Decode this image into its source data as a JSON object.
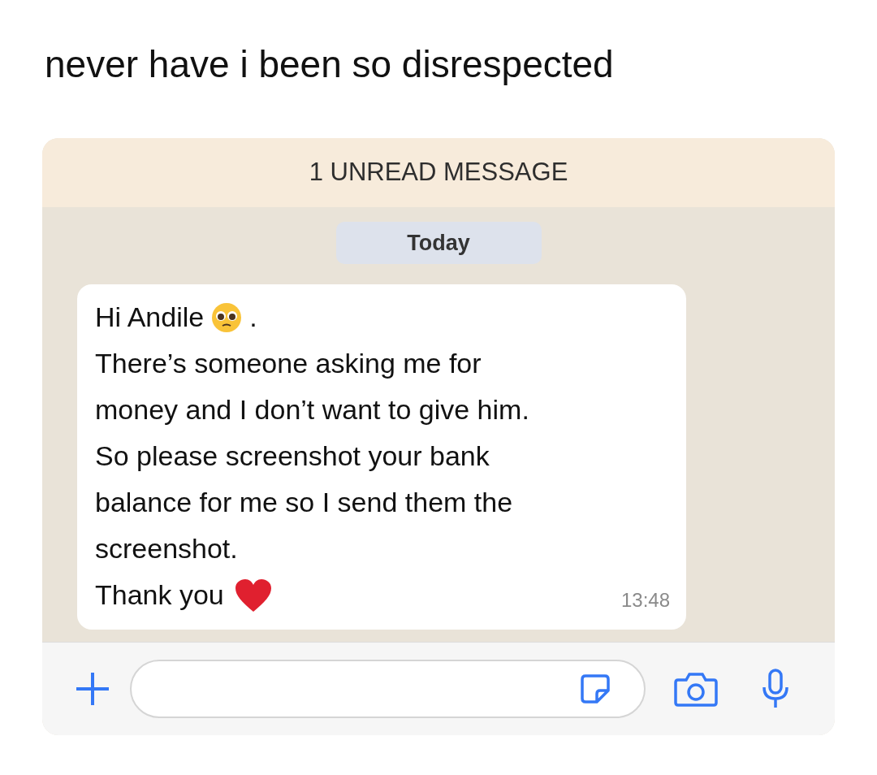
{
  "caption": "never have i been so disrespected",
  "chat": {
    "unread_banner": "1 UNREAD MESSAGE",
    "date_chip": "Today",
    "message": {
      "lines": [
        {
          "kind": "pleading",
          "text": "Hi Andile",
          "suffix": "."
        },
        {
          "kind": "plain",
          "text": "There’s someone asking me for"
        },
        {
          "kind": "plain",
          "text": "money and I don’t want to give him."
        },
        {
          "kind": "plain",
          "text": "So please screenshot your bank"
        },
        {
          "kind": "plain",
          "text": "balance for me so I send them the"
        },
        {
          "kind": "plain",
          "text": "screenshot."
        },
        {
          "kind": "heart",
          "text": "Thank you"
        }
      ],
      "time": "13:48"
    }
  }
}
